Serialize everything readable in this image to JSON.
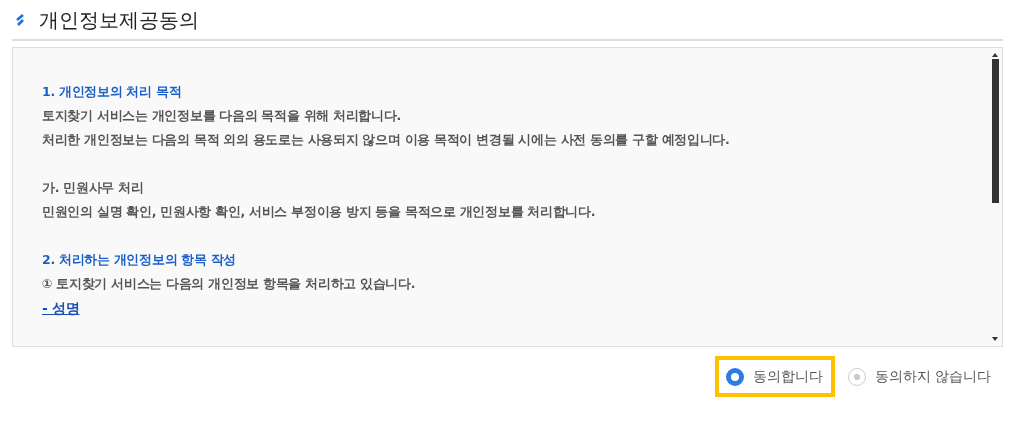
{
  "title": "개인정보제공동의",
  "terms": [
    {
      "kind": "heading",
      "text": "1. 개인정보의 처리 목적"
    },
    {
      "kind": "text",
      "text": "토지찾기 서비스는 개인정보를 다음의 목적을 위해 처리합니다."
    },
    {
      "kind": "text",
      "text": "처리한 개인정보는 다음의 목적 외의 용도로는 사용되지 않으며 이용 목적이 변경될 시에는 사전 동의를 구할 예정입니다."
    },
    {
      "kind": "subheading",
      "text": "가. 민원사무 처리"
    },
    {
      "kind": "text",
      "text": "민원인의 실명 확인, 민원사항 확인, 서비스 부정이용 방지 등을 목적으로 개인정보를 처리합니다."
    },
    {
      "kind": "heading",
      "text": "2. 처리하는 개인정보의 항목 작성"
    },
    {
      "kind": "text",
      "text": "① 토지찾기 서비스는 다음의 개인정보 항목을 처리하고 있습니다."
    },
    {
      "kind": "link",
      "text": "- 성명"
    }
  ],
  "options": [
    {
      "label": "동의합니다",
      "selected": true
    },
    {
      "label": "동의하지 않습니다",
      "selected": false
    }
  ]
}
